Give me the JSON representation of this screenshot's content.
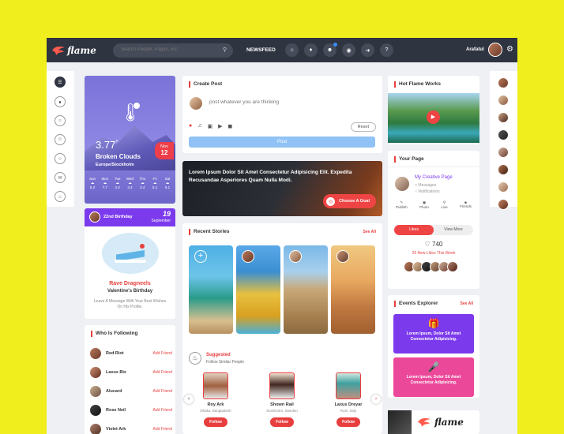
{
  "app": {
    "name": "flame"
  },
  "header": {
    "search_placeholder": "Search People, Pages, Etc",
    "newsfeed": "NEWSFEED",
    "username": "Arafatul",
    "icons": [
      "home-icon",
      "bell-icon",
      "user-add-icon",
      "globe-icon",
      "logout-icon",
      "help-icon"
    ]
  },
  "weather": {
    "temp": "3.77",
    "degree": "°",
    "condition": "Broken Clouds",
    "location": "Europe/Stockholm",
    "month": "Nov",
    "day": "12",
    "days": [
      {
        "name": "Sun",
        "temp": "5.2"
      },
      {
        "name": "Mon",
        "temp": "7.7"
      },
      {
        "name": "Tue",
        "temp": "4.3"
      },
      {
        "name": "Wed",
        "temp": "3.4"
      },
      {
        "name": "Thu",
        "temp": "3.4"
      },
      {
        "name": "Fri",
        "temp": "5.1"
      },
      {
        "name": "Sat",
        "temp": "5.1"
      }
    ]
  },
  "birthday": {
    "label": "22nd Birthday",
    "day": "19",
    "month": "September",
    "name": "Rave Dragneels",
    "title": "Valentine's Birthday",
    "message": "Leave A Message With Your Best Wishes On His Profile."
  },
  "who_following": {
    "title": "Who Is Following",
    "people": [
      {
        "name": "Red Riot",
        "action": "Add Friend"
      },
      {
        "name": "Laxus Bix",
        "action": "Add Friend"
      },
      {
        "name": "Alucard",
        "action": "Add Friend"
      },
      {
        "name": "Rose Neil",
        "action": "Add Friend"
      },
      {
        "name": "Violet Ark",
        "action": "Add Friend"
      }
    ]
  },
  "create_post": {
    "title": "Create Post",
    "placeholder": "post whatever you are thinking",
    "reset": "Reset",
    "post": "Post"
  },
  "quote": {
    "text": "Lorem Ipsum Dolor Sit Amet Consectetur Adipisicing Elit. Expedita Recusandae Asperiores Quam Nulla Modi.",
    "button": "Choose A Goal"
  },
  "stories": {
    "title": "Recent Stories",
    "see_all": "See All"
  },
  "suggested": {
    "title": "Suggested",
    "subtitle": "Follow Similar People",
    "people": [
      {
        "name": "Roy Ark",
        "location": "Dhaka, Bangladesh",
        "action": "Follow"
      },
      {
        "name": "Shown Rail",
        "location": "Stockholm, Sweden",
        "action": "Follow"
      },
      {
        "name": "Laxus Dreyar",
        "location": "Rom, Italy",
        "action": "Follow"
      }
    ]
  },
  "hot_works": {
    "title": "Hot Flame Works"
  },
  "your_page": {
    "title": "Your Page",
    "page_name": "My Creative Page",
    "messages": "Messages",
    "notifications": "Notifications",
    "actions": [
      "Publish",
      "Photo",
      "Live",
      "Friends"
    ],
    "likes_tab": "Likes",
    "view_more": "View More",
    "like_count": "740",
    "new_likes": "29 New Likes This Week"
  },
  "events": {
    "title": "Events Explorer",
    "see_all": "See All",
    "items": [
      "Lorem Ipsum, Dolor Sit Amet Consectetur Adipisicing.",
      "Lorem Ipsum, Dolor Sit Amet Consectetur Adipisicing."
    ]
  },
  "colors": {
    "accent": "#e83e3e",
    "purple": "#7c3aed",
    "pink": "#ec4899",
    "header": "#2f3441"
  }
}
